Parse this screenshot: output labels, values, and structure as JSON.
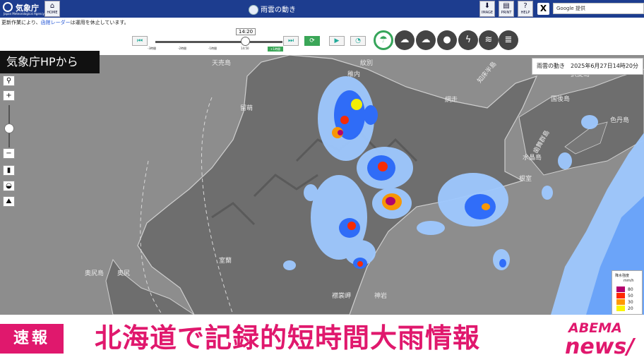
{
  "header": {
    "logo_title": "気象庁",
    "logo_subtitle": "Japan Meteorological Agency",
    "home_label": "HOME",
    "app_title": "雨雲の動き",
    "image_label": "IMAGE",
    "print_label": "PRINT",
    "help_label": "HELP",
    "x_label": "X",
    "search_placeholder": "Google 提供"
  },
  "notice": {
    "prefix": "更新作業により、",
    "link": "函館レーダー",
    "suffix": "は運用を休止しています。"
  },
  "timeline": {
    "current_time": "14:20",
    "ticks": [
      "-3時間",
      "-2時間",
      "-1時間",
      "14:50",
      "+1時間"
    ],
    "now_label": "+1時間"
  },
  "source_label": "気象庁HPから",
  "map": {
    "date_label": "雨雲の動き　2025年6月27日14時20分",
    "labels": [
      "天売島",
      "紋別",
      "網走",
      "知床半島",
      "留萌",
      "国後島",
      "択捉島",
      "歯舞群島",
      "色丹島",
      "水晶島",
      "奥尻島",
      "奥尻",
      "室蘭",
      "襟裳岬",
      "神岩",
      "根室",
      "稚内"
    ]
  },
  "legend": {
    "title": "降水強度",
    "unit": "mm/h",
    "levels": [
      {
        "value": "80",
        "color": "#b4006e"
      },
      {
        "value": "50",
        "color": "#ff2800"
      },
      {
        "value": "30",
        "color": "#ff9900"
      },
      {
        "value": "20",
        "color": "#faf500"
      }
    ]
  },
  "banner": {
    "tag": "速報",
    "headline": "北海道で記録的短時間大雨情報",
    "brand_top": "ABEMA",
    "brand_bottom": "news/"
  },
  "colors": {
    "header_bg": "#1d3d8f",
    "accent": "#e0186d",
    "green": "#36a55a"
  }
}
